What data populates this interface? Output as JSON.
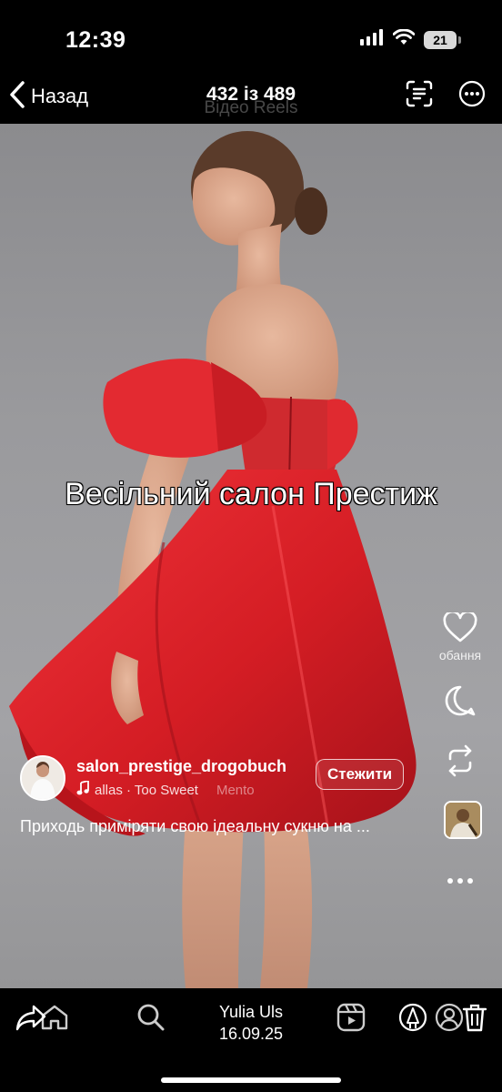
{
  "status_bar": {
    "time": "12:39",
    "battery": "21"
  },
  "nav": {
    "back_label": "Назад",
    "counter": "432 із 489",
    "ghost_subtitle": "Відео Reels"
  },
  "reel": {
    "overlay_caption": "Весільний салон Престиж",
    "like_label": "обання",
    "author": {
      "username": "salon_prestige_drogobuch",
      "audio_artist": "allas · Too Sweet",
      "audio_extra": "Mento"
    },
    "follow_label": "Стежити",
    "description": "Приходь приміряти свою ідеальну сукню на ..."
  },
  "message": {
    "sender": "Yulia Uls",
    "date": "16.09.25"
  },
  "colors": {
    "dress": "#e0262c",
    "background": "#9a9a9d"
  }
}
